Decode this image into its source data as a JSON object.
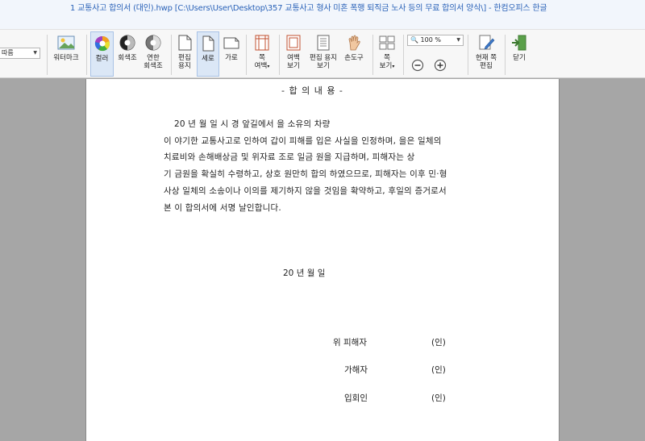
{
  "window": {
    "title": "1 교통사고 합의서 (대인).hwp [C:\\Users\\User\\Desktop\\357 교통사고 형사 미혼 폭행 퇴직금 노사 등의 무료 합의서 양식\\] - 한컴오피스 한글"
  },
  "ribbon": {
    "left_combo": {
      "value": "따름"
    },
    "watermark": {
      "label": "워터마크"
    },
    "color": {
      "label": "컬러"
    },
    "grayscale": {
      "label": "회색조"
    },
    "light_grayscale": {
      "label_line1": "연한",
      "label_line2": "회색조"
    },
    "edit_paper": {
      "label_line1": "편집",
      "label_line2": "용지"
    },
    "portrait": {
      "label": "세로"
    },
    "landscape": {
      "label": "가로"
    },
    "page_margin": {
      "label_line1": "쪽",
      "label_line2": "여백"
    },
    "margin_view": {
      "label_line1": "여백",
      "label_line2": "보기"
    },
    "edit_paper_view": {
      "label_line1": "편집 용지",
      "label_line2": "보기"
    },
    "hand_tool": {
      "label": "손도구"
    },
    "page_view": {
      "label_line1": "쪽",
      "label_line2": "보기"
    },
    "zoom": {
      "value": "100 %"
    },
    "current_page_edit": {
      "label_line1": "현재 쪽",
      "label_line2": "편집"
    },
    "close": {
      "label": "닫기"
    }
  },
  "document": {
    "heading": "- 합 의 내 용 -",
    "paragraph_lines": [
      "20   년     월    일    시   경                    앞길에서 을 소유의                  차량",
      "이 야기한 교통사고로 인하여 갑이 피해를 입은 사실을 인정하며, 을은 일체의",
      "치료비와 손해배상금 및 위자료 조로 일금              원을 지급하며, 피해자는 상",
      "기 금원을 확실히 수령하고, 상호 원만히 합의 하였으므로, 피해자는 이후 민·형",
      "사상 일체의 소송이나 이의를 제기하지 않을 것임을 확약하고, 후일의 증거로서",
      "본 이 합의서에 서명 날인합니다."
    ],
    "date_line": "20   년     월     일",
    "signatures": [
      {
        "role": "위 피해자",
        "seal": "(인)"
      },
      {
        "role": "가해자",
        "seal": "(인)"
      },
      {
        "role": "입회인",
        "seal": "(인)"
      }
    ]
  }
}
